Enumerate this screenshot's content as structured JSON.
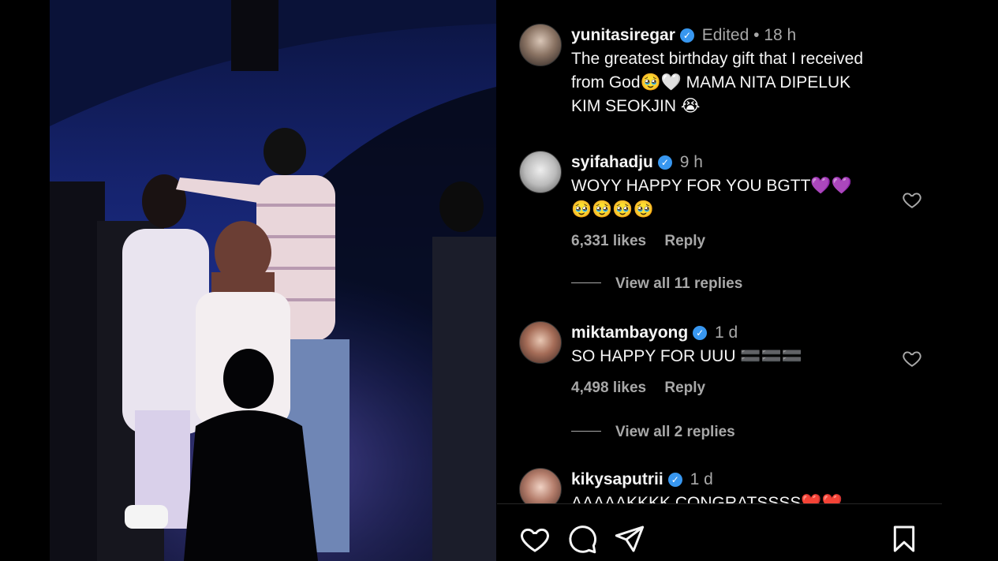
{
  "post": {
    "author": "yunitasiregar",
    "edited": "Edited",
    "separator": "•",
    "time": "18 h",
    "caption_line1": "The greatest birthday gift that I received",
    "caption_line2": "from God🥹🤍 MAMA NITA DIPELUK",
    "caption_line3": "KIM SEOKJIN 😭"
  },
  "comments": [
    {
      "username": "syifahadju",
      "time": "9 h",
      "text_line1": "WOYY HAPPY FOR YOU BGTT💜💜",
      "text_line2": "🥹🥹🥹🥹",
      "likes": "6,331 likes",
      "reply": "Reply",
      "view_replies": "View all 11 replies"
    },
    {
      "username": "miktambayong",
      "time": "1 d",
      "text_line1": "SO HAPPY FOR UUU 🟰🟰🟰",
      "likes": "4,498 likes",
      "reply": "Reply",
      "view_replies": "View all 2 replies"
    },
    {
      "username": "kikysaputrii",
      "time": "1 d",
      "text_line1": "AAAAAKKKK CONGRATSSSS❤️❤️"
    }
  ],
  "icons": {
    "verified": "verified-badge-icon",
    "like": "heart-icon",
    "comment": "comment-icon",
    "share": "share-icon",
    "save": "bookmark-icon"
  },
  "colors": {
    "verified": "#3897f0",
    "muted": "#a8a8a8",
    "background": "#000000"
  }
}
